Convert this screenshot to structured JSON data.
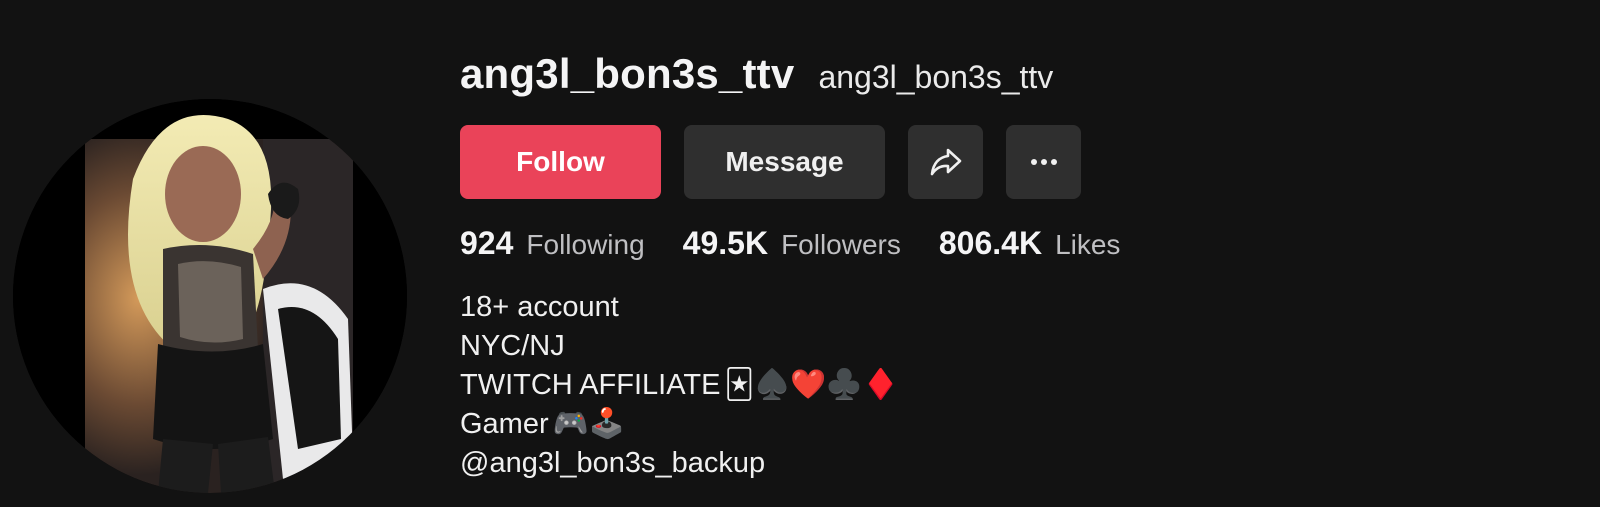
{
  "profile": {
    "username": "ang3l_bon3s_ttv",
    "nickname": "ang3l_bon3s_ttv"
  },
  "actions": {
    "follow_label": "Follow",
    "message_label": "Message",
    "share_icon": "share-arrow-icon",
    "more_icon": "more-dots-icon"
  },
  "stats": {
    "following": {
      "value": "924",
      "label": "Following"
    },
    "followers": {
      "value": "49.5K",
      "label": "Followers"
    },
    "likes": {
      "value": "806.4K",
      "label": "Likes"
    }
  },
  "bio": {
    "line1": "18+ account",
    "line2": "NYC/NJ",
    "line3": "TWITCH AFFILIATE",
    "line3_emojis": "🃏♠️❤️♣️♦️",
    "line4": "Gamer",
    "line4_emojis": "🎮🕹️",
    "line5": "@ang3l_bon3s_backup"
  },
  "colors": {
    "background": "#121212",
    "follow_button": "#ea4359",
    "secondary_button": "#2f2f2f"
  }
}
